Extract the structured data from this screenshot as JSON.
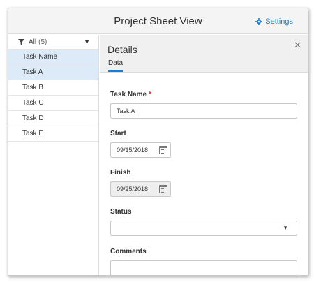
{
  "window": {
    "title": "Project Sheet View"
  },
  "header": {
    "settings_label": "Settings"
  },
  "sidebar": {
    "filter": {
      "label": "All",
      "count": "(5)"
    },
    "column_header": "Task Name",
    "rows": [
      "Task A",
      "Task B",
      "Task C",
      "Task D",
      "Task E"
    ]
  },
  "details": {
    "title": "Details",
    "tab": "Data",
    "task_name": {
      "label": "Task Name",
      "required_mark": "*",
      "value": "Task A"
    },
    "start": {
      "label": "Start",
      "value": "09/15/2018"
    },
    "finish": {
      "label": "Finish",
      "value": "09/25/2018"
    },
    "status": {
      "label": "Status",
      "value": ""
    },
    "comments": {
      "label": "Comments",
      "value": ""
    }
  },
  "colors": {
    "accent": "#1a7bd4",
    "selection": "#dcebf7",
    "required": "#d9262c"
  }
}
